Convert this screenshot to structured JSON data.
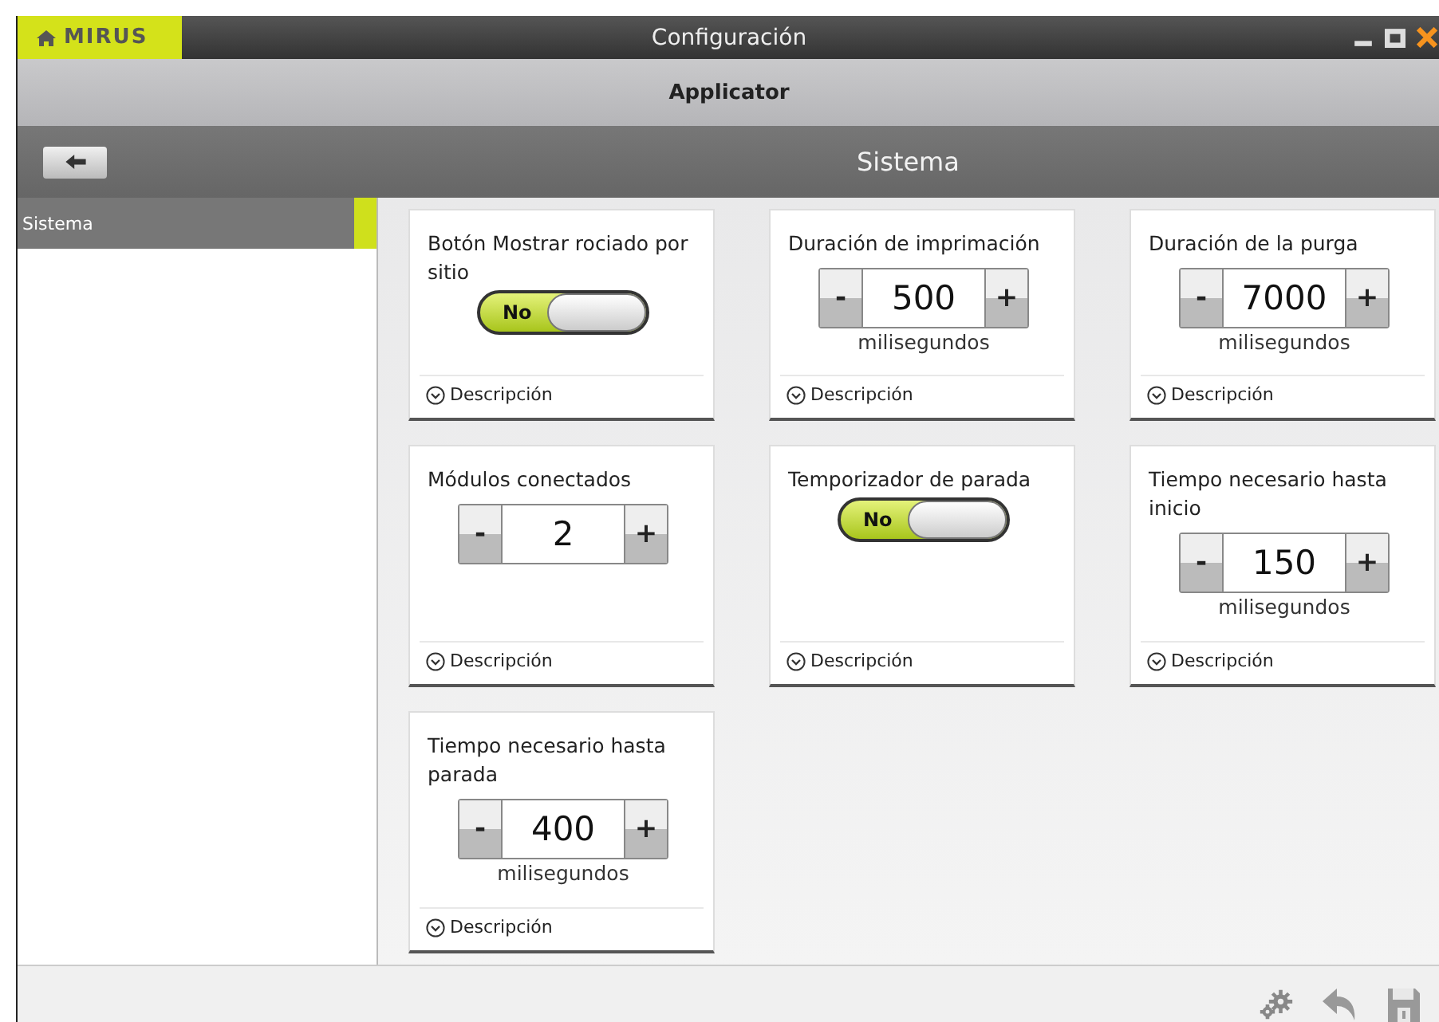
{
  "window": {
    "brand": "MIRUS",
    "title": "Configuración"
  },
  "app_bar": {
    "title": "Applicator"
  },
  "nav_bar": {
    "title": "Sistema"
  },
  "sidebar": {
    "items": [
      {
        "label": "Sistema",
        "selected": true
      }
    ]
  },
  "settings": [
    {
      "kind": "toggle",
      "label": "Botón Mostrar rociado por sitio",
      "on": false,
      "state_text": "No",
      "description": "Descripción"
    },
    {
      "kind": "stepper",
      "label": "Duración de imprimación",
      "minus": "-",
      "value": "500",
      "plus": "+",
      "unit": "milisegundos",
      "description": "Descripción"
    },
    {
      "kind": "stepper",
      "label": "Duración de la purga",
      "minus": "-",
      "value": "7000",
      "plus": "+",
      "unit": "milisegundos",
      "description": "Descripción"
    },
    {
      "kind": "stepper",
      "label": "Módulos conectados",
      "minus": "-",
      "value": "2",
      "plus": "+",
      "description": "Descripción"
    },
    {
      "kind": "toggle",
      "label": "Temporizador de parada",
      "on": false,
      "state_text": "No",
      "description": "Descripción"
    },
    {
      "kind": "stepper",
      "label": "Tiempo necesario hasta inicio",
      "minus": "-",
      "value": "150",
      "plus": "+",
      "unit": "milisegundos",
      "description": "Descripción"
    },
    {
      "kind": "stepper",
      "label": "Tiempo necesario hasta parada",
      "minus": "-",
      "value": "400",
      "plus": "+",
      "unit": "milisegundos",
      "description": "Descripción"
    }
  ]
}
